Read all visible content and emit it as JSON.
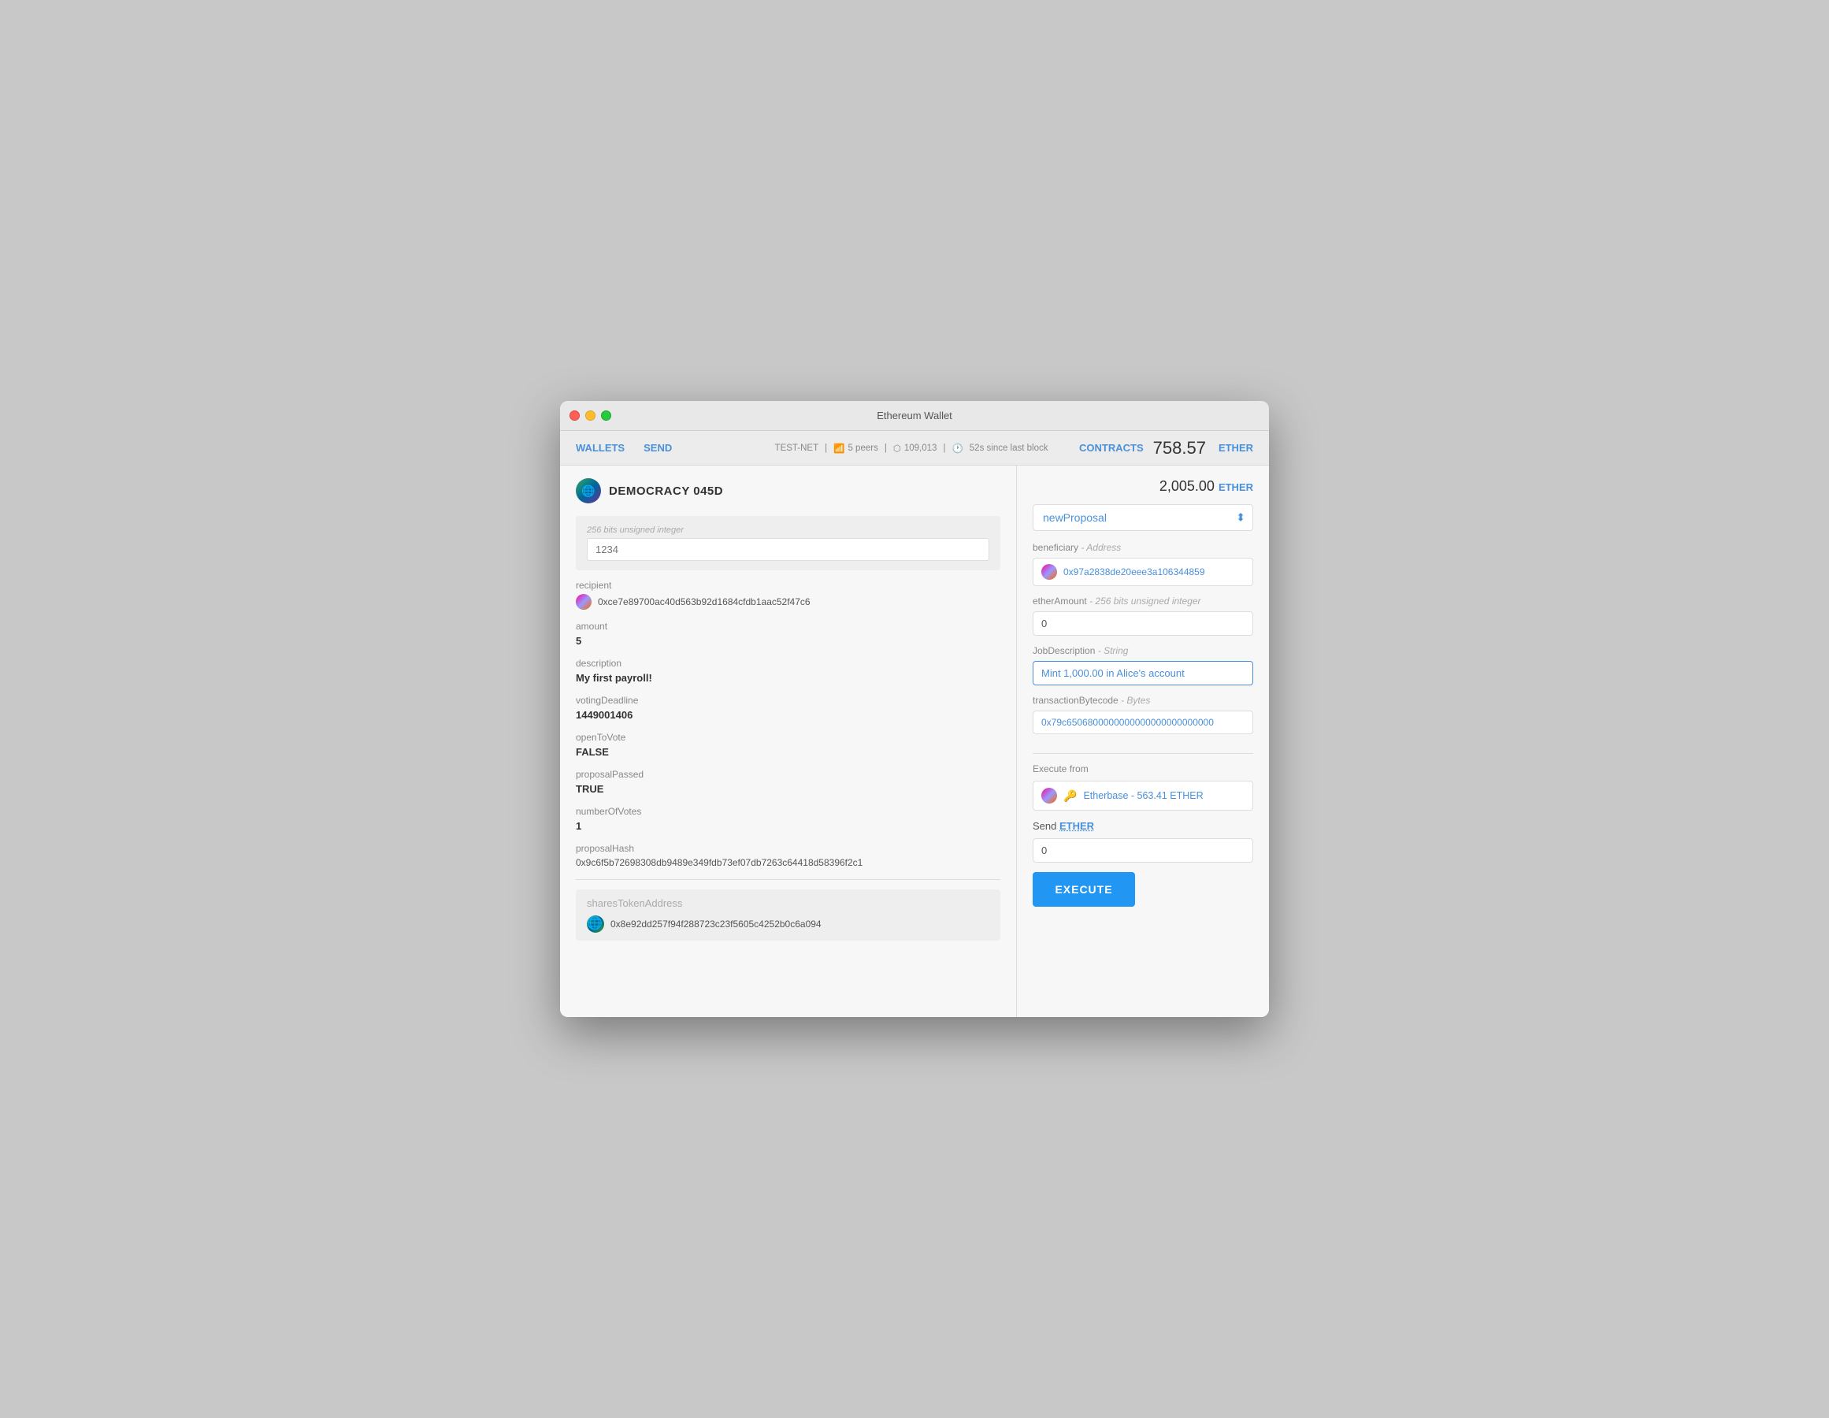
{
  "window": {
    "title": "Ethereum Wallet"
  },
  "navbar": {
    "wallets_label": "WALLETS",
    "send_label": "SEND",
    "network": "TEST-NET",
    "peers": "5 peers",
    "blocks": "109,013",
    "last_block": "52s since last block",
    "contracts_label": "CONTRACTS",
    "balance": "758.57",
    "balance_unit": "ETHER"
  },
  "left": {
    "contract_name": "DEMOCRACY 045D",
    "contract_balance": "2,005.00",
    "contract_balance_unit": "ETHER",
    "uint_label": "256 bits unsigned integer",
    "uint_placeholder": "1234",
    "fields": [
      {
        "label": "recipient",
        "value": ""
      },
      {
        "address": "0xce7e89700ac40d563b92d1684cfdb1aac52f47c6"
      },
      {
        "label": "amount",
        "value": "5"
      },
      {
        "label": "description",
        "value": "My first payroll!"
      },
      {
        "label": "votingDeadline",
        "value": "1449001406"
      },
      {
        "label": "openToVote",
        "value": "FALSE"
      },
      {
        "label": "proposalPassed",
        "value": "TRUE"
      },
      {
        "label": "numberOfVotes",
        "value": "1"
      },
      {
        "label": "proposalHash",
        "value": "0x9c6f5b72698308db9489e349fdb73ef07db7263c64418d58396f2c1"
      }
    ],
    "shares_label": "sharesTokenAddress",
    "shares_address": "0x8e92dd257f94f288723c23f5605c4252b0c6a094"
  },
  "right": {
    "function_label": "newProposal",
    "beneficiary_label": "beneficiary",
    "beneficiary_sublabel": "Address",
    "beneficiary_address": "0x97a2838de20eee3a106344859",
    "ether_amount_label": "etherAmount",
    "ether_amount_sublabel": "256 bits unsigned integer",
    "ether_amount_value": "0",
    "job_desc_label": "JobDescription",
    "job_desc_sublabel": "String",
    "job_desc_value": "Mint 1,000.00 in Alice's account",
    "tx_bytecode_label": "transactionBytecode",
    "tx_bytecode_sublabel": "Bytes",
    "tx_bytecode_value": "0x79c6506800000000000000000000000",
    "execute_from_label": "Execute from",
    "execute_from_value": "Etherbase - 563.41 ETHER",
    "send_ether_label": "Send",
    "send_ether_unit": "ETHER",
    "send_ether_value": "0",
    "execute_label": "EXECUTE"
  }
}
